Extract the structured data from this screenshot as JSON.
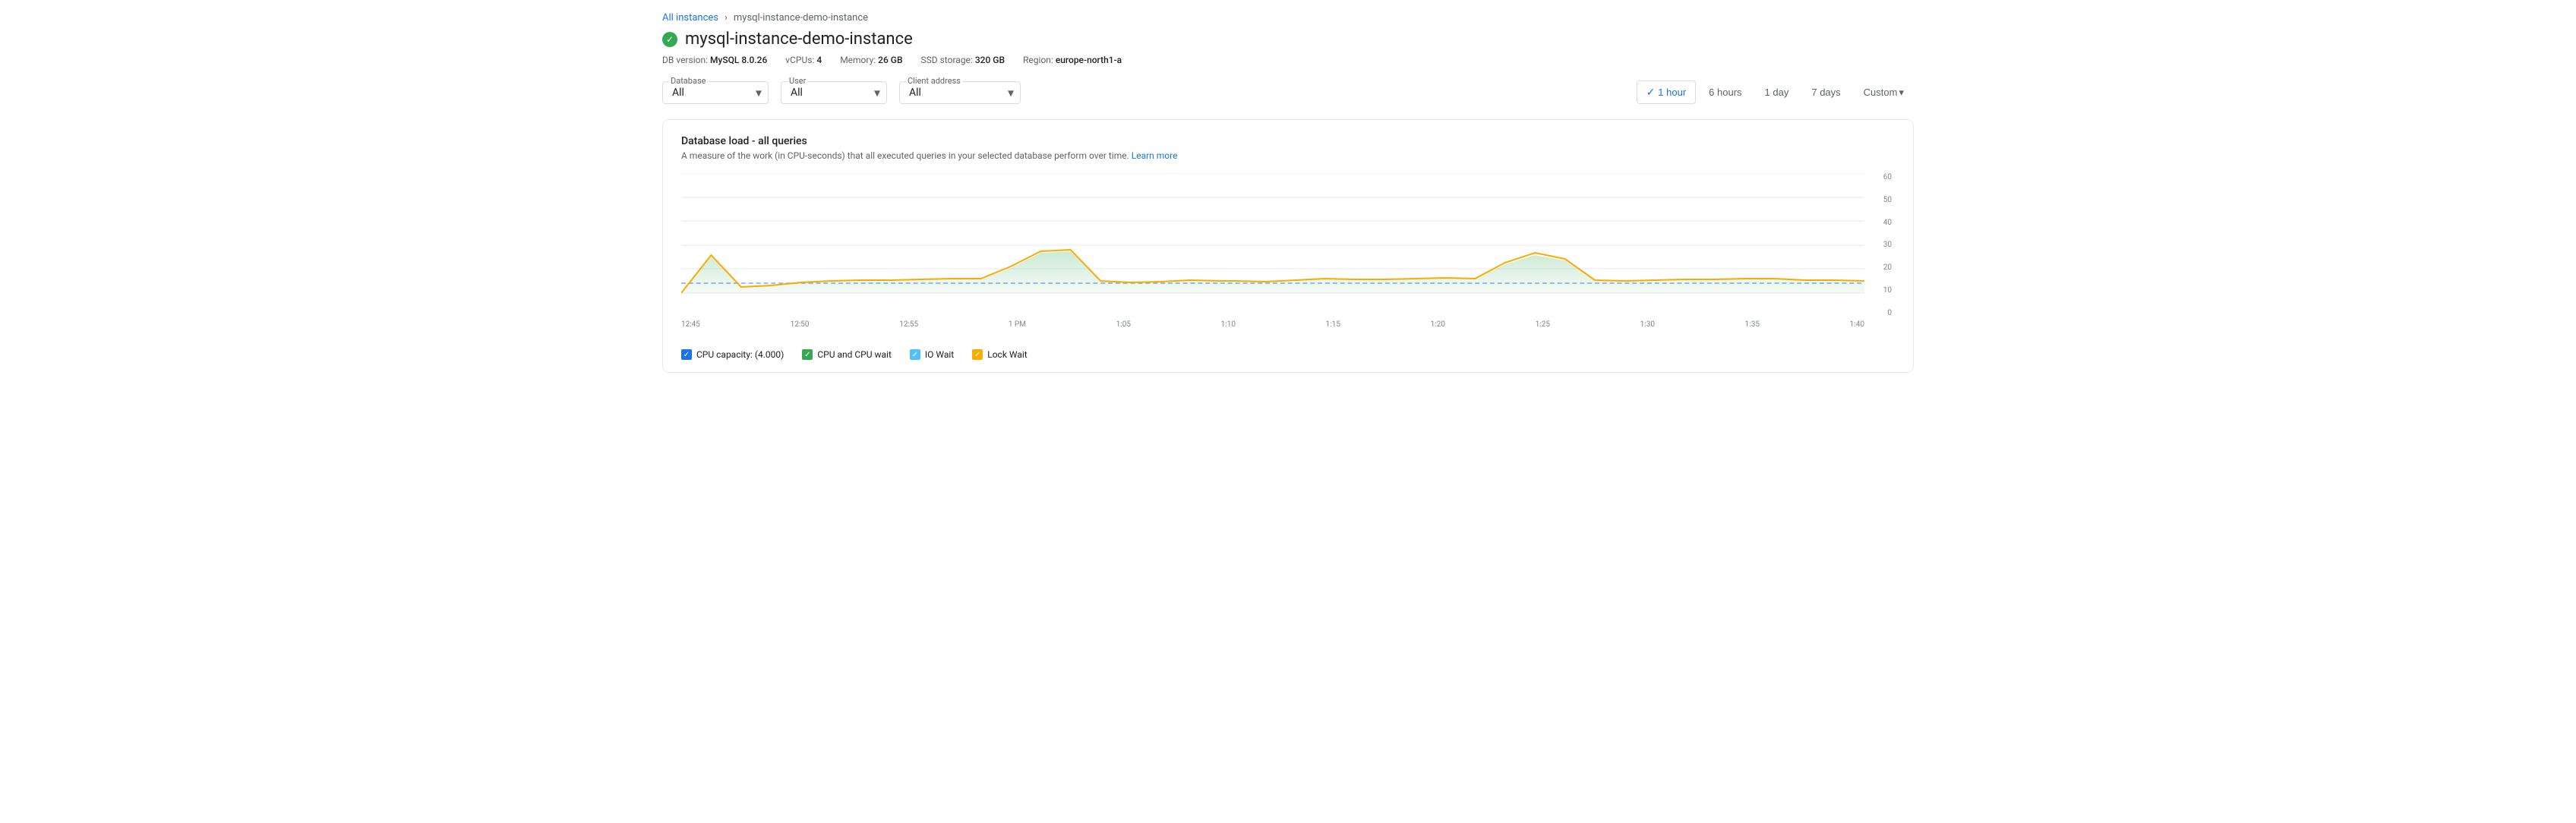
{
  "breadcrumb": {
    "parent_label": "All instances",
    "separator": "›",
    "current": "mysql-instance-demo-instance"
  },
  "instance": {
    "name": "mysql-instance-demo-instance",
    "status_icon": "✓",
    "db_version_label": "DB version:",
    "db_version": "MySQL 8.0.26",
    "vcpus_label": "vCPUs:",
    "vcpus": "4",
    "memory_label": "Memory:",
    "memory": "26 GB",
    "storage_label": "SSD storage:",
    "storage": "320 GB",
    "region_label": "Region:",
    "region": "europe-north1-a"
  },
  "filters": {
    "database": {
      "label": "Database",
      "value": "All"
    },
    "user": {
      "label": "User",
      "value": "All"
    },
    "client_address": {
      "label": "Client address",
      "value": "All"
    }
  },
  "time_range": {
    "options": [
      "1 hour",
      "6 hours",
      "1 day",
      "7 days",
      "Custom"
    ],
    "active": "1 hour",
    "custom_label": "Custom"
  },
  "chart": {
    "title": "Database load - all queries",
    "subtitle": "A measure of the work (in CPU-seconds) that all executed queries in your selected database perform over time.",
    "learn_more": "Learn more",
    "y_labels": [
      "0",
      "10",
      "20",
      "30",
      "40",
      "50",
      "60"
    ],
    "x_labels": [
      "12:45",
      "12:50",
      "12:55",
      "1 PM",
      "1:05",
      "1:10",
      "1:15",
      "1:20",
      "1:25",
      "1:30",
      "1:35",
      "1:40"
    ],
    "legend": [
      {
        "label": "CPU capacity: (4.000)",
        "color": "blue"
      },
      {
        "label": "CPU and CPU wait",
        "color": "green"
      },
      {
        "label": "IO Wait",
        "color": "light-blue"
      },
      {
        "label": "Lock Wait",
        "color": "orange"
      }
    ]
  }
}
